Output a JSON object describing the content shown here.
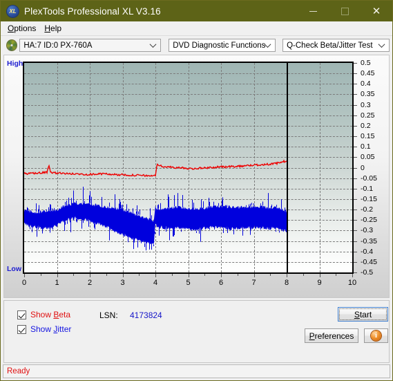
{
  "window": {
    "title": "PlexTools Professional XL V3.16",
    "app_icon": "XL",
    "minimize": "minimize-icon",
    "maximize": "maximize-icon",
    "close": "close-icon"
  },
  "menu": [
    {
      "label": "Options",
      "accel": "O"
    },
    {
      "label": "Help",
      "accel": "H"
    }
  ],
  "toolbar": {
    "drive_icon": "disc-icon",
    "drive": "HA:7 ID:0  PX-760A",
    "function": "DVD Diagnostic Functions",
    "test": "Q-Check Beta/Jitter Test"
  },
  "controls": {
    "show_beta": "Show Beta",
    "show_beta_accel": "B",
    "show_jitter": "Show Jitter",
    "show_jitter_accel": "J",
    "show_beta_checked": true,
    "show_jitter_checked": true,
    "lsn_label": "LSN:",
    "lsn_value": "4173824",
    "start": "Start",
    "start_accel": "S",
    "preferences": "Preferences",
    "preferences_accel": "P",
    "info": "i"
  },
  "status": {
    "text": "Ready"
  },
  "chart_data": {
    "type": "line",
    "title": "Q-Check Beta/Jitter Test",
    "xlabel": "",
    "ylabel": "",
    "y_axis_top_label": "High",
    "y_axis_bottom_label": "Low",
    "xlim": [
      0,
      10
    ],
    "ylim": [
      -0.5,
      0.5
    ],
    "grid": true,
    "legend_position": "bottom-left",
    "x_ticks": [
      0,
      1,
      2,
      3,
      4,
      5,
      6,
      7,
      8,
      9,
      10
    ],
    "x_tick_labels": [
      "0",
      "1",
      "2",
      "3",
      "4",
      "5",
      "6",
      "7",
      "8",
      "9",
      "10"
    ],
    "y_ticks": [
      0.5,
      0.45,
      0.4,
      0.35,
      0.3,
      0.25,
      0.2,
      0.15,
      0.1,
      0.05,
      0,
      -0.05,
      -0.1,
      -0.15,
      -0.2,
      -0.25,
      -0.3,
      -0.35,
      -0.4,
      -0.45,
      -0.5
    ],
    "y_tick_labels": [
      "0.5",
      "0.45",
      "0.4",
      "0.35",
      "0.3",
      "0.25",
      "0.2",
      "0.15",
      "0.1",
      "0.05",
      "0",
      "-0.05",
      "-0.1",
      "-0.15",
      "-0.2",
      "-0.25",
      "-0.3",
      "-0.35",
      "-0.4",
      "-0.45",
      "-0.5"
    ],
    "data_end_x": 8.0,
    "marker_line_x": 8.0,
    "colors": {
      "beta": "#ee0000",
      "jitter": "#0000dd",
      "axis_labels": "#2020d0"
    },
    "series": [
      {
        "name": "Beta",
        "color": "#ee0000",
        "x": [
          0.0,
          0.1,
          0.2,
          0.3,
          0.4,
          0.5,
          0.6,
          0.7,
          0.75,
          0.8,
          0.85,
          0.9,
          1.0,
          1.1,
          1.2,
          1.3,
          1.4,
          1.5,
          1.6,
          1.7,
          1.8,
          1.9,
          2.0,
          2.1,
          2.2,
          2.3,
          2.4,
          2.5,
          2.6,
          2.7,
          2.8,
          2.9,
          3.0,
          3.1,
          3.2,
          3.3,
          3.4,
          3.5,
          3.6,
          3.7,
          3.8,
          3.9,
          3.95,
          4.0,
          4.05,
          4.1,
          4.2,
          4.3,
          4.4,
          4.5,
          4.6,
          4.7,
          4.8,
          4.9,
          5.0,
          5.2,
          5.4,
          5.6,
          5.8,
          6.0,
          6.2,
          6.4,
          6.6,
          6.8,
          7.0,
          7.2,
          7.4,
          7.6,
          7.8,
          7.9,
          8.0
        ],
        "y": [
          -0.028,
          -0.03,
          -0.028,
          -0.026,
          -0.026,
          -0.025,
          -0.024,
          -0.022,
          0.01,
          -0.022,
          -0.022,
          -0.024,
          -0.026,
          -0.026,
          -0.027,
          -0.028,
          -0.029,
          -0.03,
          -0.03,
          -0.031,
          -0.031,
          -0.032,
          -0.032,
          -0.031,
          -0.031,
          -0.03,
          -0.029,
          -0.03,
          -0.031,
          -0.032,
          -0.033,
          -0.034,
          -0.034,
          -0.035,
          -0.035,
          -0.036,
          -0.036,
          -0.037,
          -0.037,
          -0.038,
          -0.038,
          -0.038,
          -0.039,
          -0.04,
          0.02,
          0.012,
          0.006,
          0.004,
          0.003,
          0.002,
          0.001,
          0.0,
          -0.001,
          -0.002,
          -0.004,
          -0.004,
          -0.002,
          0.0,
          0.002,
          0.004,
          0.004,
          0.006,
          0.008,
          0.01,
          0.012,
          0.014,
          0.016,
          0.018,
          0.024,
          0.03,
          0.03
        ]
      },
      {
        "name": "Jitter",
        "color": "#0000dd",
        "x": [
          0.0,
          0.2,
          0.4,
          0.6,
          0.8,
          1.0,
          1.2,
          1.4,
          1.6,
          1.8,
          2.0,
          2.2,
          2.4,
          2.6,
          2.8,
          3.0,
          3.2,
          3.4,
          3.6,
          3.8,
          3.95,
          4.0,
          4.05,
          4.2,
          4.4,
          4.6,
          4.8,
          5.0,
          5.2,
          5.4,
          5.6,
          5.8,
          6.0,
          6.2,
          6.4,
          6.6,
          6.8,
          7.0,
          7.2,
          7.4,
          7.6,
          7.8,
          7.95,
          8.0
        ],
        "y_upper": [
          -0.205,
          -0.21,
          -0.215,
          -0.21,
          -0.205,
          -0.2,
          -0.185,
          -0.175,
          -0.17,
          -0.17,
          -0.175,
          -0.18,
          -0.185,
          -0.19,
          -0.195,
          -0.2,
          -0.21,
          -0.225,
          -0.235,
          -0.245,
          -0.26,
          -0.18,
          -0.195,
          -0.2,
          -0.195,
          -0.19,
          -0.19,
          -0.195,
          -0.195,
          -0.195,
          -0.19,
          -0.185,
          -0.185,
          -0.185,
          -0.19,
          -0.19,
          -0.19,
          -0.185,
          -0.185,
          -0.19,
          -0.19,
          -0.195,
          -0.205,
          -0.21
        ],
        "y_lower": [
          -0.265,
          -0.28,
          -0.285,
          -0.29,
          -0.285,
          -0.275,
          -0.255,
          -0.245,
          -0.24,
          -0.245,
          -0.255,
          -0.265,
          -0.275,
          -0.29,
          -0.305,
          -0.32,
          -0.33,
          -0.345,
          -0.355,
          -0.36,
          -0.37,
          -0.27,
          -0.28,
          -0.285,
          -0.29,
          -0.29,
          -0.29,
          -0.295,
          -0.295,
          -0.29,
          -0.285,
          -0.285,
          -0.285,
          -0.29,
          -0.29,
          -0.29,
          -0.285,
          -0.285,
          -0.285,
          -0.29,
          -0.29,
          -0.295,
          -0.3,
          -0.305
        ]
      }
    ]
  }
}
